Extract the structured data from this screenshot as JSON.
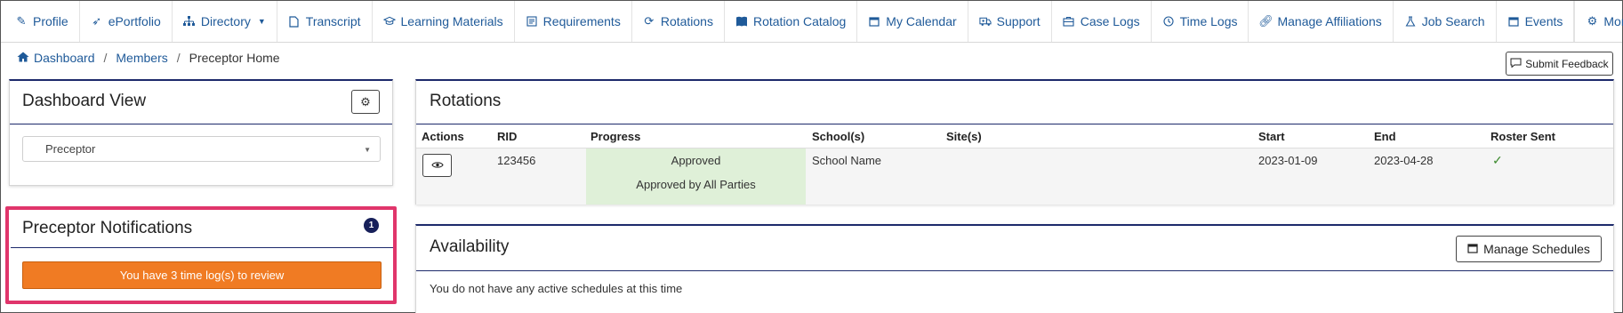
{
  "nav": {
    "items": [
      {
        "icon": "pencil-icon",
        "label": "Profile"
      },
      {
        "icon": "rocket-icon",
        "label": "ePortfolio"
      },
      {
        "icon": "sitemap-icon",
        "label": "Directory"
      },
      {
        "icon": "file-icon",
        "label": "Transcript"
      },
      {
        "icon": "graduation-cap-icon",
        "label": "Learning Materials"
      },
      {
        "icon": "list-icon",
        "label": "Requirements"
      },
      {
        "icon": "refresh-icon",
        "label": "Rotations"
      },
      {
        "icon": "book-icon",
        "label": "Rotation Catalog"
      },
      {
        "icon": "calendar-icon",
        "label": "My Calendar"
      },
      {
        "icon": "ambulance-icon",
        "label": "Support"
      },
      {
        "icon": "briefcase-icon",
        "label": "Case Logs"
      },
      {
        "icon": "clock-icon",
        "label": "Time Logs"
      },
      {
        "icon": "link-icon",
        "label": "Manage Affiliations"
      },
      {
        "icon": "flask-icon",
        "label": "Job Search"
      },
      {
        "icon": "calendar-icon",
        "label": "Events"
      }
    ],
    "more_label": "More"
  },
  "breadcrumb": {
    "dashboard": "Dashboard",
    "members": "Members",
    "current": "Preceptor Home",
    "sep": "/"
  },
  "feedback_button": "Submit Feedback",
  "dashboard_view": {
    "title": "Dashboard View",
    "selected": "Preceptor"
  },
  "notifications": {
    "title": "Preceptor Notifications",
    "badge": "1",
    "button": "You have 3 time log(s) to review"
  },
  "rotations": {
    "title": "Rotations",
    "headers": {
      "actions": "Actions",
      "rid": "RID",
      "progress": "Progress",
      "schools": "School(s)",
      "sites": "Site(s)",
      "start": "Start",
      "end": "End",
      "roster": "Roster Sent"
    },
    "row": {
      "rid": "123456",
      "status": "Approved",
      "status_detail": "Approved by All Parties",
      "school": "School Name",
      "site": "",
      "start": "2023-01-09",
      "end": "2023-04-28",
      "roster_sent": "✓"
    }
  },
  "availability": {
    "title": "Availability",
    "button": "Manage Schedules",
    "message": "You do not have any active schedules at this time"
  },
  "colors": {
    "link": "#1f5a99",
    "card_accent": "#1d2a6b",
    "orange_button": "#f07b23",
    "highlight": "#e0356b",
    "progress_bg": "#dff0d8"
  }
}
